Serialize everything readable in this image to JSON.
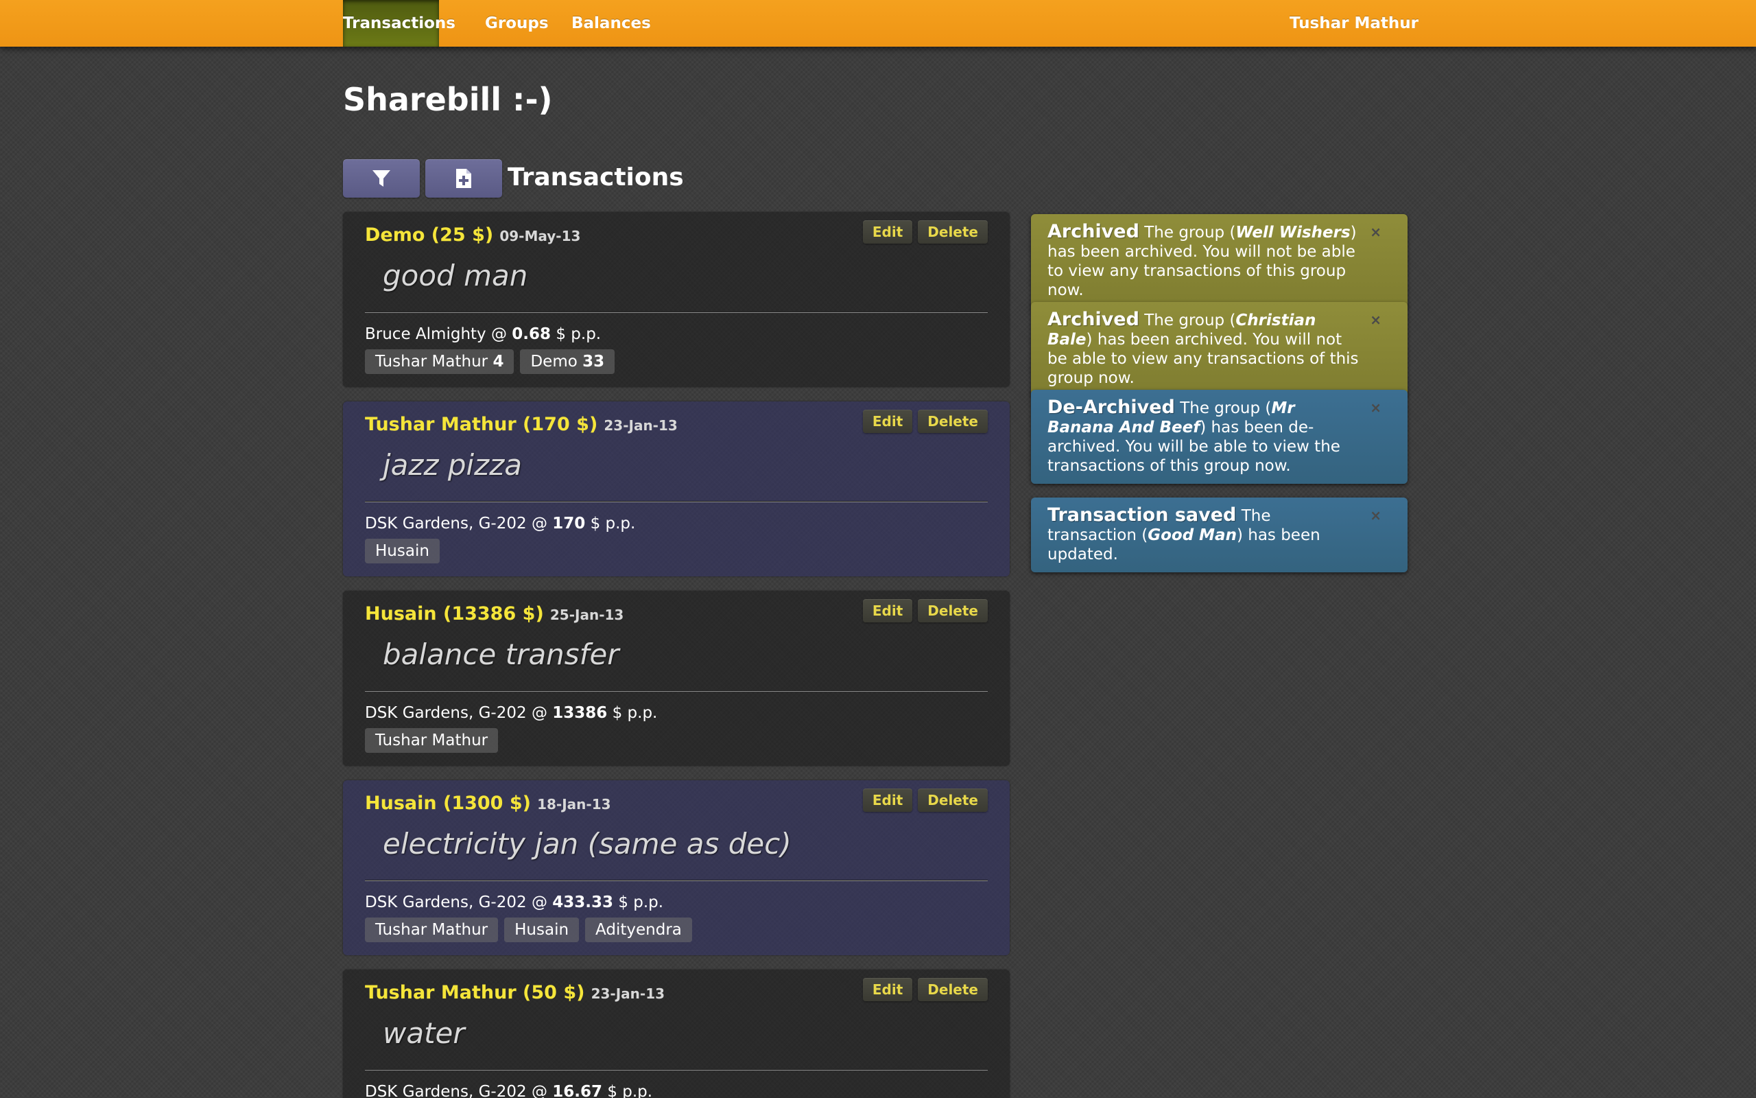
{
  "nav": {
    "items": [
      {
        "label": "Transactions",
        "active": true
      },
      {
        "label": "Groups",
        "active": false
      },
      {
        "label": "Balances",
        "active": false
      }
    ],
    "user": "Tushar Mathur"
  },
  "page": {
    "title": "Sharebill :-)",
    "section_title": "Transactions"
  },
  "toolbar": {
    "filter_icon": "filter-icon",
    "add_icon": "add-document-icon"
  },
  "actions": {
    "edit_label": "Edit",
    "delete_label": "Delete",
    "pp_label": "$ p.p."
  },
  "transactions": [
    {
      "payer": "Demo (25 $)",
      "date": "09-May-13",
      "description": "good man",
      "location": "Bruce Almighty @",
      "amount": "0.68",
      "members": [
        {
          "name": "Tushar Mathur",
          "share": "4"
        },
        {
          "name": "Demo",
          "share": "33"
        }
      ]
    },
    {
      "payer": "Tushar Mathur (170 $)",
      "date": "23-Jan-13",
      "description": "jazz pizza",
      "location": "DSK Gardens, G-202 @",
      "amount": "170",
      "members": [
        {
          "name": "Husain",
          "share": ""
        }
      ]
    },
    {
      "payer": "Husain (13386 $)",
      "date": "25-Jan-13",
      "description": "balance transfer",
      "location": "DSK Gardens, G-202 @",
      "amount": "13386",
      "members": [
        {
          "name": "Tushar Mathur",
          "share": ""
        }
      ]
    },
    {
      "payer": "Husain (1300 $)",
      "date": "18-Jan-13",
      "description": "electricity jan (same as dec)",
      "location": "DSK Gardens, G-202 @",
      "amount": "433.33",
      "members": [
        {
          "name": "Tushar Mathur",
          "share": ""
        },
        {
          "name": "Husain",
          "share": ""
        },
        {
          "name": "Adityendra",
          "share": ""
        }
      ]
    },
    {
      "payer": "Tushar Mathur (50 $)",
      "date": "23-Jan-13",
      "description": "water",
      "location": "DSK Gardens, G-202 @",
      "amount": "16.67",
      "members": []
    }
  ],
  "notifications": [
    {
      "title": "Archived",
      "text_before": "The group (",
      "emphasis": "Well Wishers",
      "text_after": ") has been archived. You will not be able to view any transactions of this group now.",
      "close": "×",
      "color": "#8a8836"
    },
    {
      "title": "Archived",
      "text_before": "The group (",
      "emphasis": "Christian Bale",
      "text_after": ") has been archived. You will not be able to view any transactions of this group now.",
      "close": "×",
      "color": "#8a8836"
    },
    {
      "title": "De-Archived",
      "text_before": "The group (",
      "emphasis": "Mr Banana And Beef",
      "text_after": ") has been de-archived. You will be able to view the transactions of this group now.",
      "close": "×",
      "color": "#386a8a"
    },
    {
      "title": "Transaction saved",
      "text_before": "The transaction (",
      "emphasis": "Good Man",
      "text_after": ") has been updated.",
      "close": "×",
      "color": "#386a8a"
    }
  ],
  "colors": {
    "navbar": "#f29a16",
    "nav_active": "#5f6c12",
    "payer_text": "#f5e53a",
    "card_alt": "#343462"
  }
}
